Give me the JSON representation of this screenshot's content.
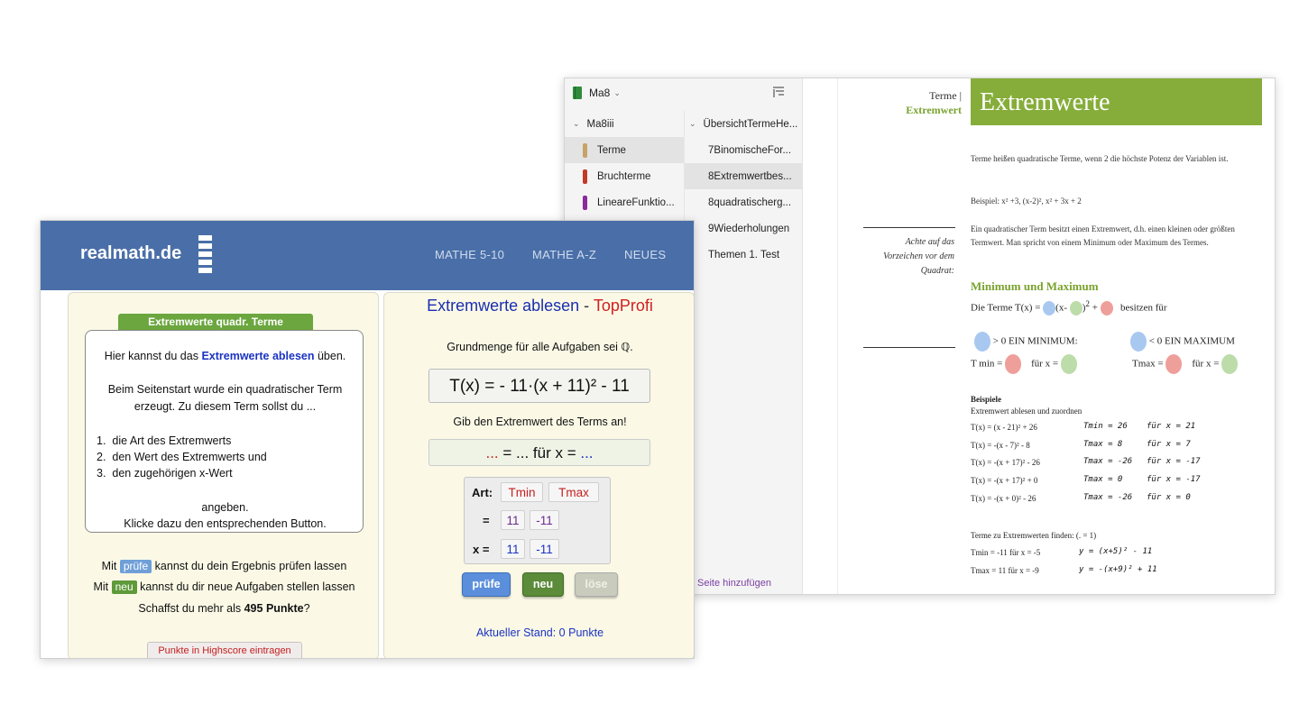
{
  "onenote": {
    "notebook_name": "Ma8",
    "sections": [
      {
        "label": "Ma8iii",
        "group": true
      },
      {
        "label": "Terme",
        "color": "#c8a26a",
        "active": true
      },
      {
        "label": "Bruchterme",
        "color": "#c23a2a"
      },
      {
        "label": "LineareFunktio...",
        "color": "#8b2a9a"
      }
    ],
    "pages": [
      {
        "label": "ÜbersichtTermeHe...",
        "group": true
      },
      {
        "label": "7BinomischeFor..."
      },
      {
        "label": "8Extremwertbes...",
        "active": true
      },
      {
        "label": "8quadratischerg..."
      },
      {
        "label": "9Wiederholungen"
      },
      {
        "label": "Themen 1. Test"
      }
    ],
    "add_page": "Seite hinzufügen",
    "page": {
      "breadcrumb_main": "Terme |",
      "breadcrumb_sub": "Extremwert",
      "title": "Extremwerte",
      "intro": "Terme heißen quadratische Terme, wenn 2 die höchste Potenz der Variablen ist.",
      "example": "Beispiel: x² +3, (x-2)², x² + 3x + 2",
      "extreme_text": "Ein quadratischer Term besitzt einen Extremwert, d.h. einen kleinen oder größten Termwert. Man spricht von einem Minimum oder Maximum des Termes.",
      "side_note": "Achte auf das Vorzeichen vor dem Quadrat:",
      "heading": "Minimum und Maximum",
      "terms_intro_a": "Die Terme T(x) =",
      "terms_intro_b": "(x-",
      "terms_intro_c": ")",
      "terms_intro_exp": "2",
      "terms_intro_d": "+",
      "terms_intro_e": "besitzen für",
      "min_label": "> 0 EIN MINIMUM:",
      "max_label": "< 0 EIN MAXIMUM",
      "tmin_label": "T min =",
      "tmax_label": "Tmax =",
      "fuer_x": "für x =",
      "beispiele_heading": "Beispiele",
      "beispiele_sub": "Extremwert ablesen und zuordnen",
      "examples": [
        {
          "term": "T(x) = (x - 21)² + 26",
          "hw1": "Tmin = 26",
          "hw2": "für x = 21"
        },
        {
          "term": "T(x) = -(x - 7)² - 8",
          "hw1": "Tmax = 8",
          "hw2": "für x = 7"
        },
        {
          "term": "T(x) = -(x + 17)² - 26",
          "hw1": "Tmax = -26",
          "hw2": "für x = -17"
        },
        {
          "term": "T(x) = -(x + 17)² + 0",
          "hw1": "Tmax = 0",
          "hw2": "für x = -17"
        },
        {
          "term": "T(x) = -(x + 0)² - 26",
          "hw1": "Tmax = -26",
          "hw2": "für x = 0"
        }
      ],
      "find_heading": "Terme zu Extremwerten finden: (.     = 1)",
      "find_rows": [
        {
          "text": "Tmin = -11 für x = -5",
          "hw": "y = (x+5)² - 11"
        },
        {
          "text": "Tmax = 11 für x = -9",
          "hw": "y = -(x+9)² + 11"
        }
      ]
    }
  },
  "realmath": {
    "logo": "realmath.de",
    "nav": [
      "MATHE 5-10",
      "MATHE A-Z",
      "NEUES"
    ],
    "left": {
      "tag": "Extremwerte quadr. Terme",
      "line1_a": "Hier kannst du das",
      "line1_b": "Extremwerte ablesen",
      "line1_c": "üben.",
      "line2": "Beim Seitenstart wurde ein quadratischer Term",
      "line3": "erzeugt. Zu diesem Term sollst du ...",
      "list": [
        "die Art des Extremwerts",
        "den Wert des Extremwerts und",
        "den zugehörigen x-Wert"
      ],
      "line4": "angeben.",
      "line5": "Klicke dazu den entsprechenden Button.",
      "foot1_a": "Mit",
      "foot1_chip": "prüfe",
      "foot1_b": "kannst du dein Ergebnis prüfen lassen",
      "foot2_a": "Mit",
      "foot2_chip": "neu",
      "foot2_b": "kannst du dir neue Aufgaben stellen lassen",
      "foot3_a": "Schaffst du mehr als",
      "foot3_b": "495 Punkte",
      "foot3_c": "?",
      "highscore_button": "Punkte in Highscore eintragen"
    },
    "right": {
      "title_a": "Extremwerte ablesen",
      "title_dash": " - ",
      "title_b": "TopProfi",
      "grundmenge": "Grundmenge für alle Aufgaben sei ℚ.",
      "term": "T(x) = - 11·(x + 11)² - 11",
      "prompt": "Gib den Extremwert des Terms an!",
      "answer_a": "...",
      "answer_b": " = ... für x = ",
      "answer_c": "...",
      "art_label": "Art:",
      "eq_label": "=",
      "x_label": "x =",
      "art_options": [
        "Tmin",
        "Tmax"
      ],
      "value_options": [
        "11",
        "-11"
      ],
      "x_options": [
        "11",
        "-11"
      ],
      "btn_pruefe": "prüfe",
      "btn_neu": "neu",
      "btn_loese": "löse",
      "stand": "Aktueller Stand: 0 Punkte"
    }
  }
}
